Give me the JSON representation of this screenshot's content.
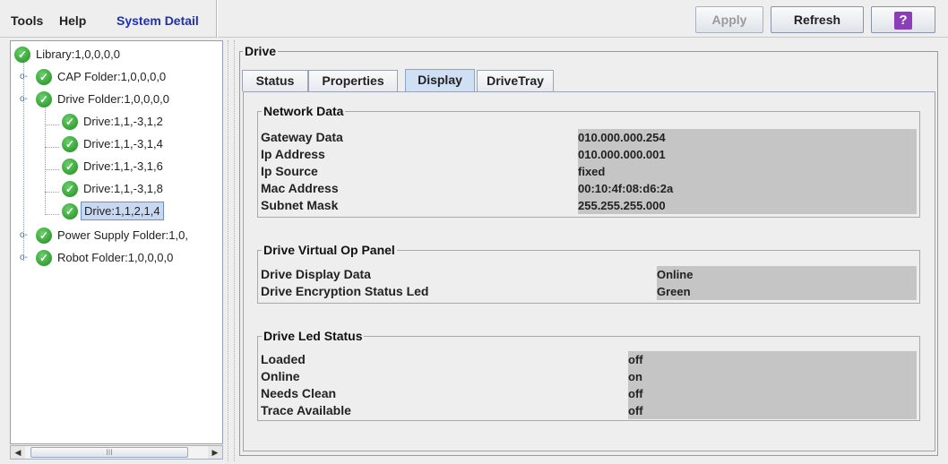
{
  "menubar": {
    "items": [
      {
        "label": "Tools"
      },
      {
        "label": "Help"
      },
      {
        "label": "System Detail"
      }
    ],
    "apply_label": "Apply",
    "refresh_label": "Refresh",
    "help_label": "?"
  },
  "tree": {
    "root": "Library:1,0,0,0,0",
    "cap_folder": "CAP Folder:1,0,0,0,0",
    "drive_folder": "Drive Folder:1,0,0,0,0",
    "drives": [
      "Drive:1,1,-3,1,2",
      "Drive:1,1,-3,1,4",
      "Drive:1,1,-3,1,6",
      "Drive:1,1,-3,1,8",
      "Drive:1,1,2,1,4"
    ],
    "power_folder": "Power Supply Folder:1,0,",
    "robot_folder": "Robot Folder:1,0,0,0,0",
    "selected": "Drive:1,1,2,1,4",
    "scroll_thumb": "III"
  },
  "panel": {
    "title": "Drive",
    "tabs": [
      "Status",
      "Properties",
      "Display",
      "DriveTray"
    ],
    "active_tab": "Display"
  },
  "network": {
    "title": "Network Data",
    "rows": [
      {
        "key": "Gateway Data",
        "value": "010.000.000.254"
      },
      {
        "key": "Ip Address",
        "value": "010.000.000.001"
      },
      {
        "key": "Ip Source",
        "value": "fixed"
      },
      {
        "key": "Mac Address",
        "value": "00:10:4f:08:d6:2a"
      },
      {
        "key": "Subnet Mask",
        "value": "255.255.255.000"
      }
    ]
  },
  "op_panel": {
    "title": "Drive Virtual Op Panel",
    "rows": [
      {
        "key": "Drive Display Data",
        "value": "Online"
      },
      {
        "key": "Drive Encryption Status Led",
        "value": "Green"
      }
    ]
  },
  "led": {
    "title": "Drive Led Status",
    "rows": [
      {
        "key": "Loaded",
        "value": "off"
      },
      {
        "key": "Online",
        "value": "on"
      },
      {
        "key": "Needs Clean",
        "value": "off"
      },
      {
        "key": "Trace Available",
        "value": "off"
      }
    ]
  },
  "colors": {
    "menu_selected": "#1f2fb8",
    "ok_green": "#1e8c1e",
    "active_tab": "#cfe0f5",
    "value_bg": "#c5c5c5"
  }
}
